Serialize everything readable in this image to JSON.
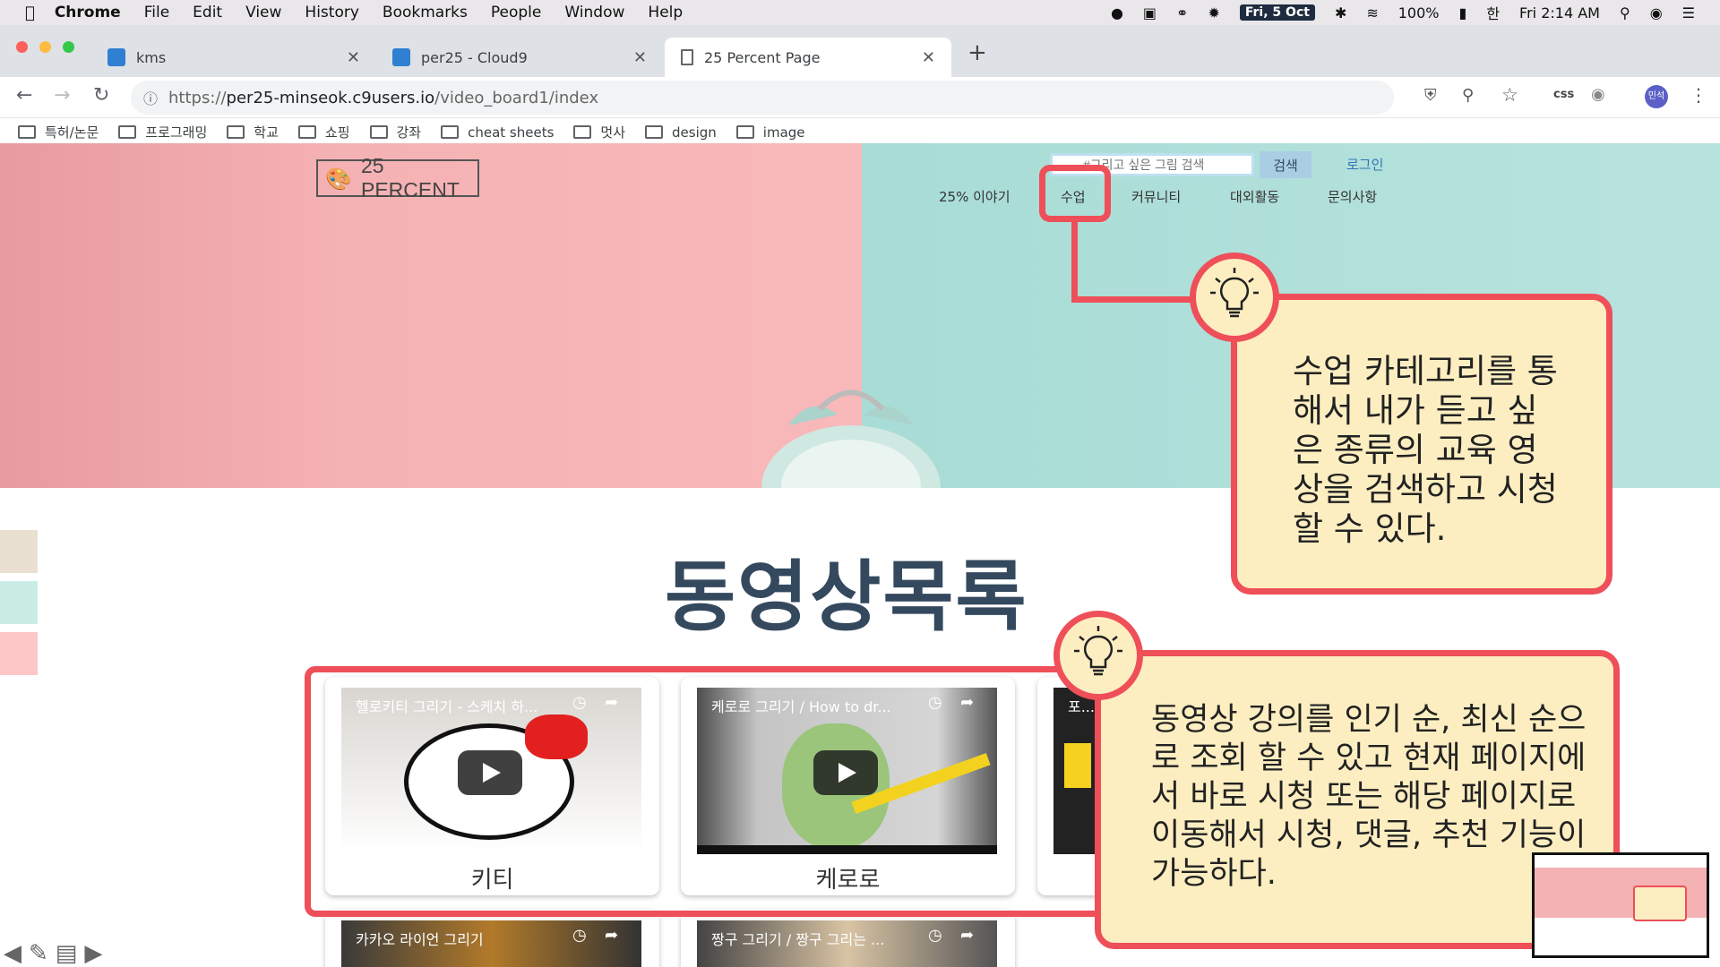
{
  "menubar": {
    "app": "Chrome",
    "items": [
      "File",
      "Edit",
      "View",
      "History",
      "Bookmarks",
      "People",
      "Window",
      "Help"
    ],
    "date": "Fri, 5 Oct",
    "battery": "100%",
    "input_source": "한",
    "time": "Fri 2:14 AM"
  },
  "tabs": [
    {
      "title": "kms"
    },
    {
      "title": "per25 - Cloud9"
    },
    {
      "title": "25 Percent Page"
    }
  ],
  "address": {
    "scheme": "https://",
    "host": "per25-minseok.c9users.io",
    "path": "/video_board1/index"
  },
  "toolbar": {
    "css_ext": "css",
    "profile": "민석"
  },
  "bookmarks": [
    "특허/논문",
    "프로그래밍",
    "학교",
    "쇼핑",
    "강좌",
    "cheat sheets",
    "멋사",
    "design",
    "image"
  ],
  "site": {
    "logo_text": "25 PERCENT",
    "search_placeholder": "#그리고 싶은 그림 검색",
    "search_button": "검색",
    "login": "로그인",
    "nav": [
      "25% 이야기",
      "수업",
      "커뮤니티",
      "대외활동",
      "문의사항"
    ],
    "heading": "동영상목록"
  },
  "annotations": {
    "note1": "수업 카테고리를 통해서 내가 듣고 싶은 종류의 교육 영상을 검색하고 시청할 수 있다.",
    "note2": "동영상 강의를 인기 순, 최신 순으로 조회 할 수 있고 현재 페이지에서 바로 시청 또는 해당 페이지로 이동해서 시청, 댓글, 추천 기능이 가능하다."
  },
  "videos": [
    {
      "title": "헬로키티 그리기 - 스케치 하...",
      "label": "키티"
    },
    {
      "title": "케로로 그리기 / How to dr...",
      "label": "케로로"
    },
    {
      "title": "포...",
      "label": ""
    },
    {
      "title": "카카오 라이언 그리기",
      "label": ""
    },
    {
      "title": "짱구 그리기 / 짱구 그리는 ...",
      "label": ""
    }
  ],
  "colors": {
    "accent": "#ee4f59",
    "note_bg": "#fdeec1",
    "hero_pink": "#f5b2b4",
    "hero_mint": "#b9e3de"
  }
}
